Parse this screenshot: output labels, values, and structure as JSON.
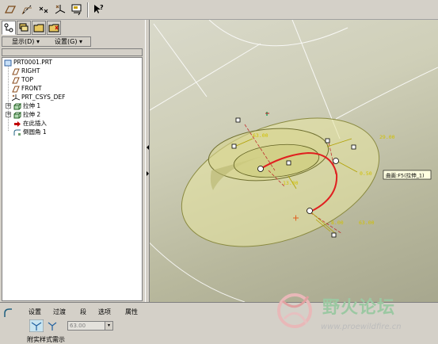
{
  "toolbar": {
    "buttons": [
      "plane-icon",
      "axis-icon",
      "point-icon",
      "csys-icon",
      "analysis-icon",
      "whats-this-icon"
    ]
  },
  "left_panel": {
    "tabs": [
      "model-tree-tab",
      "layers-tab",
      "folder-tab",
      "favorites-tab"
    ],
    "menus": {
      "display": "显示(D) ▾",
      "settings": "设置(G) ▾"
    },
    "tree": [
      {
        "label": "PRT0001.PRT",
        "icon": "part-icon"
      },
      {
        "label": "RIGHT",
        "icon": "datum-plane-icon"
      },
      {
        "label": "TOP",
        "icon": "datum-plane-icon"
      },
      {
        "label": "FRONT",
        "icon": "datum-plane-icon"
      },
      {
        "label": "PRT_CSYS_DEF",
        "icon": "csys-icon"
      },
      {
        "label": "拉伸 1",
        "icon": "extrude-icon"
      },
      {
        "label": "拉伸 2",
        "icon": "extrude-icon"
      },
      {
        "label": "在此插入",
        "icon": "insert-here-icon"
      },
      {
        "label": "倒圆角 1",
        "icon": "round-icon"
      }
    ]
  },
  "viewport": {
    "tooltip": "曲面:F5(拉伸_1)",
    "dimensions": [
      "63.00",
      "29.00",
      "0.50",
      "13.00",
      "8.00",
      "63.00"
    ]
  },
  "dashboard": {
    "tabs": [
      "设置",
      "过渡",
      "段",
      "选项",
      "属性"
    ],
    "radius_value": "63.00",
    "status": "附实样式需示"
  },
  "watermark": {
    "brand": "野火论坛",
    "url": "www.proewildfire.cn"
  }
}
